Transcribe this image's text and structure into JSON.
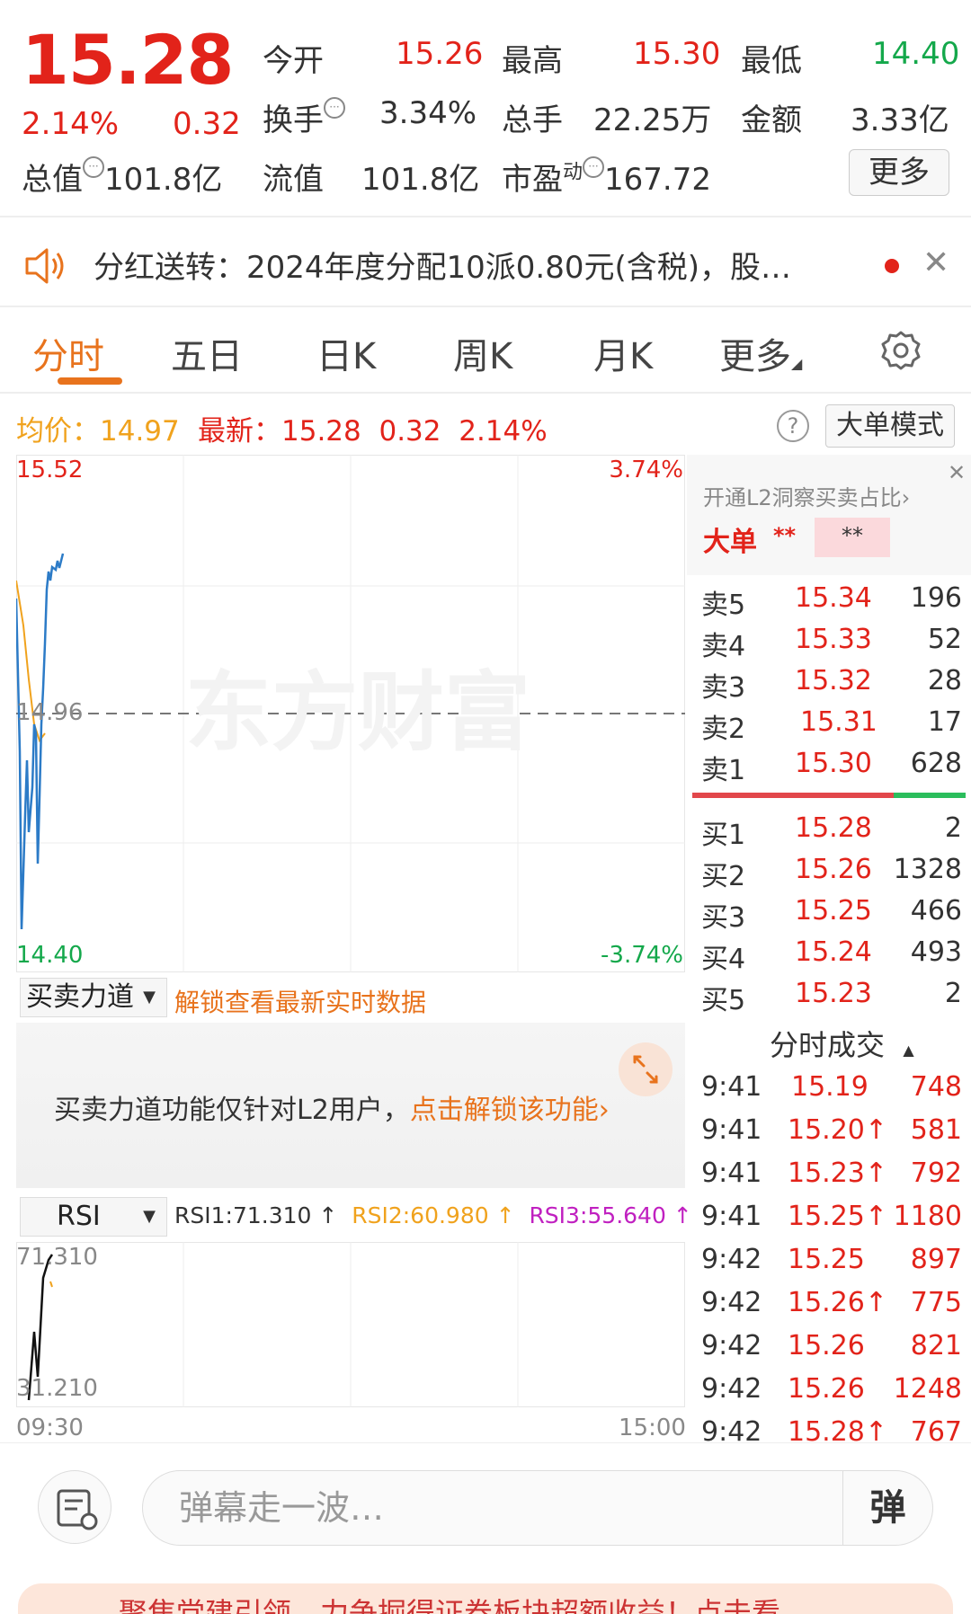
{
  "header": {
    "price": "15.28",
    "change_pct": "2.14%",
    "change_amt": "0.32",
    "open_label": "今开",
    "open_val": "15.26",
    "high_label": "最高",
    "high_val": "15.30",
    "low_label": "最低",
    "low_val": "14.40",
    "turnover_label": "换手",
    "turnover_val": "3.34%",
    "volume_label": "总手",
    "volume_val": "22.25万",
    "amount_label": "金额",
    "amount_val": "3.33亿",
    "mktcap_label": "总值",
    "mktcap_val": "101.8亿",
    "float_label": "流值",
    "float_val": "101.8亿",
    "pe_label": "市盈",
    "pe_sup": "动",
    "pe_val": "167.72",
    "more_label": "更多"
  },
  "notice": {
    "text": "分红送转：2024年度分配10派0.80元(含税)，股…"
  },
  "tabs": [
    "分时",
    "五日",
    "日K",
    "周K",
    "月K",
    "更多"
  ],
  "info_line": {
    "avg_label": "均价：",
    "avg_val": "14.97",
    "latest_label": "最新：",
    "latest_val": "15.28",
    "change_amt": "0.32",
    "change_pct": "2.14%",
    "help_icon": "?",
    "bigorder_label": "大单模式"
  },
  "chart": {
    "top_price": "15.52",
    "top_pct": "3.74%",
    "mid_price": "14.96",
    "bottom_price": "14.40",
    "bottom_pct": "-3.74%",
    "watermark": "东方财富",
    "time_start": "09:30",
    "time_end": "15:00"
  },
  "force_panel": {
    "select_label": "买卖力道",
    "unlock_link": "解锁查看最新实时数据",
    "l2_text": "买卖力道功能仅针对L2用户，",
    "l2_link": "点击解锁该功能›"
  },
  "rsi": {
    "select_label": "RSI",
    "rsi1": "RSI1:71.310 ↑",
    "rsi2": "RSI2:60.980 ↑",
    "rsi3": "RSI3:55.640 ↑",
    "top": "71.310",
    "bottom": "31.210"
  },
  "order_book": {
    "l2_banner": "开通L2洞察买卖占比›",
    "bigorder_label": "大单",
    "bigorder_val1": "**",
    "bigorder_val2": "**",
    "sells": [
      {
        "label": "卖5",
        "price": "15.34",
        "vol": "196"
      },
      {
        "label": "卖4",
        "price": "15.33",
        "vol": "52"
      },
      {
        "label": "卖3",
        "price": "15.32",
        "vol": "28"
      },
      {
        "label": "卖2",
        "price": "15.31",
        "vol": "17"
      },
      {
        "label": "卖1",
        "price": "15.30",
        "vol": "628"
      }
    ],
    "buys": [
      {
        "label": "买1",
        "price": "15.28",
        "vol": "2"
      },
      {
        "label": "买2",
        "price": "15.26",
        "vol": "1328"
      },
      {
        "label": "买3",
        "price": "15.25",
        "vol": "466"
      },
      {
        "label": "买4",
        "price": "15.24",
        "vol": "493"
      },
      {
        "label": "买5",
        "price": "15.23",
        "vol": "2"
      }
    ],
    "trades_title": "分时成交",
    "trades": [
      {
        "time": "9:41",
        "price": "15.19",
        "vol": "748"
      },
      {
        "time": "9:41",
        "price": "15.20↑",
        "vol": "581"
      },
      {
        "time": "9:41",
        "price": "15.23↑",
        "vol": "792"
      },
      {
        "time": "9:41",
        "price": "15.25↑",
        "vol": "1180"
      },
      {
        "time": "9:42",
        "price": "15.25",
        "vol": "897"
      },
      {
        "time": "9:42",
        "price": "15.26↑",
        "vol": "775"
      },
      {
        "time": "9:42",
        "price": "15.26",
        "vol": "821"
      },
      {
        "time": "9:42",
        "price": "15.26",
        "vol": "1248"
      },
      {
        "time": "9:42",
        "price": "15.28↑",
        "vol": "767"
      }
    ]
  },
  "comment_bar": {
    "placeholder": "弹幕走一波…",
    "send_label": "弹"
  },
  "promo": {
    "text": "聚焦党建引领，力争掘得证券板块超额收益！点击看…"
  }
}
